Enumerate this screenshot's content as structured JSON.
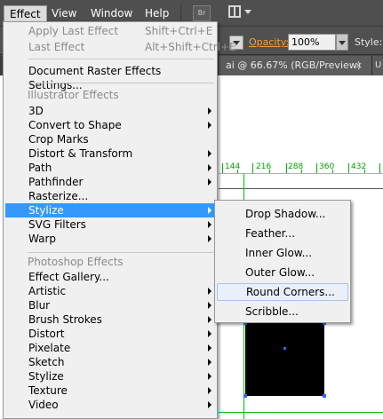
{
  "menubar": {
    "items": [
      "Effect",
      "View",
      "Window",
      "Help"
    ],
    "bridge_label": "Br"
  },
  "control_bar": {
    "opacity_label": "Opacity:",
    "opacity_value": "100%",
    "style_label": "Style:"
  },
  "document_tab": {
    "title": "ai @ 66.67% (RGB/Preview)",
    "close": "×",
    "next_tab": "U"
  },
  "ruler": {
    "labels": [
      "144",
      "216",
      "288",
      "360",
      "432"
    ]
  },
  "effect_menu": {
    "apply_last": {
      "label": "Apply Last Effect",
      "shortcut": "Shift+Ctrl+E"
    },
    "last_effect": {
      "label": "Last Effect",
      "shortcut": "Alt+Shift+Ctrl+E"
    },
    "document_raster": "Document Raster Effects Settings...",
    "illustrator_header": "Illustrator Effects",
    "illustrator_items": [
      {
        "label": "3D",
        "submenu": true
      },
      {
        "label": "Convert to Shape",
        "submenu": true
      },
      {
        "label": "Crop Marks",
        "submenu": false
      },
      {
        "label": "Distort & Transform",
        "submenu": true
      },
      {
        "label": "Path",
        "submenu": true
      },
      {
        "label": "Pathfinder",
        "submenu": true
      },
      {
        "label": "Rasterize...",
        "submenu": false
      },
      {
        "label": "Stylize",
        "submenu": true,
        "highlighted": true
      },
      {
        "label": "SVG Filters",
        "submenu": true
      },
      {
        "label": "Warp",
        "submenu": true
      }
    ],
    "photoshop_header": "Photoshop Effects",
    "photoshop_items": [
      {
        "label": "Effect Gallery...",
        "submenu": false
      },
      {
        "label": "Artistic",
        "submenu": true
      },
      {
        "label": "Blur",
        "submenu": true
      },
      {
        "label": "Brush Strokes",
        "submenu": true
      },
      {
        "label": "Distort",
        "submenu": true
      },
      {
        "label": "Pixelate",
        "submenu": true
      },
      {
        "label": "Sketch",
        "submenu": true
      },
      {
        "label": "Stylize",
        "submenu": true
      },
      {
        "label": "Texture",
        "submenu": true
      },
      {
        "label": "Video",
        "submenu": true
      }
    ]
  },
  "stylize_submenu": {
    "items": [
      "Drop Shadow...",
      "Feather...",
      "Inner Glow...",
      "Outer Glow...",
      "Round Corners...",
      "Scribble..."
    ],
    "hovered_index": 4
  },
  "colors": {
    "accent_highlight": "#3399ff",
    "guide_green": "#00c000",
    "opacity_orange": "#f0a030"
  }
}
